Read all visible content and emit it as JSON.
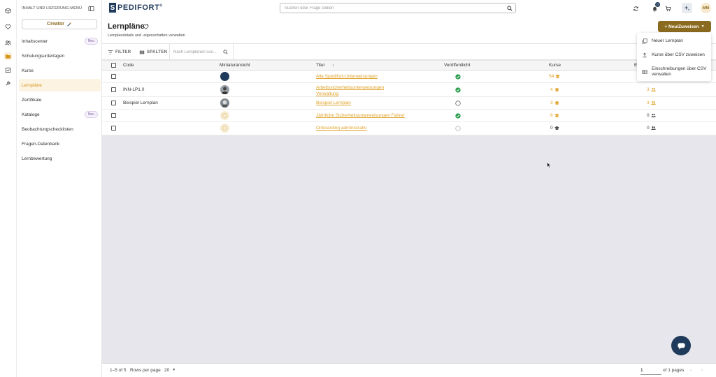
{
  "rail": {
    "icons": [
      "cube-icon",
      "heart-icon",
      "users-icon",
      "folder-icon",
      "report-icon",
      "tools-icon"
    ]
  },
  "sidebar": {
    "header": "INHALT UND LIEFERUNG-MENÜ",
    "creator_label": "Creator",
    "items": [
      {
        "label": "Inhaltscenter",
        "badge": "Neu"
      },
      {
        "label": "Schulungsunterlagen",
        "badge": ""
      },
      {
        "label": "Kurse",
        "badge": ""
      },
      {
        "label": "Lernpläne",
        "badge": ""
      },
      {
        "label": "Zertifikate",
        "badge": ""
      },
      {
        "label": "Kataloge",
        "badge": "Neu"
      },
      {
        "label": "Beobachtungschecklisten",
        "badge": ""
      },
      {
        "label": "Fragen-Datenbank",
        "badge": ""
      },
      {
        "label": "Lernbewertung",
        "badge": ""
      }
    ]
  },
  "header": {
    "logo_letter": "S",
    "logo_text": "PEDIFORT",
    "logo_reg": "®",
    "search_placeholder": "Suchen oder Frage stellen",
    "notification_count": "0",
    "avatar_initials": "MM"
  },
  "page": {
    "title": "Lernpläne",
    "subtitle": "Lernplandetails und -eigenschaften verwalten",
    "new_button": "+ Neu/Zuweisen"
  },
  "dropdown": {
    "items": [
      {
        "label": "Neuer Lernplan"
      },
      {
        "label": "Kurse über CSV zuweisen"
      },
      {
        "label": "Einschreibungen über CSV verwalten"
      }
    ]
  },
  "toolbar": {
    "filter_label": "FILTER",
    "columns_label": "SPALTEN",
    "search_placeholder": "Nach Lernplänen suc..."
  },
  "table": {
    "columns": {
      "code": "Code",
      "thumb": "Miniaturansicht",
      "title": "Titel",
      "sort": "↑",
      "published": "Veröffentlicht",
      "courses": "Kurse",
      "enroll": "E"
    },
    "rows": [
      {
        "code": "",
        "title": "Alle Spedifort-Unterweisungen",
        "published": true,
        "courses": "54",
        "enrollments": "",
        "thumb": "dark"
      },
      {
        "code": "INN-LP1.0",
        "title": "Arbeitssicherheitsunterweisungen Verwaltung",
        "published": true,
        "courses": "4",
        "enrollments": "3",
        "thumb": "photo"
      },
      {
        "code": "Beispiel Lernplan",
        "title": "Beispiel Lernplan",
        "published": false,
        "courses": "3",
        "enrollments": "3",
        "thumb": "photo2"
      },
      {
        "code": "",
        "title": "Jährliche Sicherheitsunterweisungen Fahrer",
        "published": true,
        "courses": "6",
        "enrollments": "0",
        "thumb": "placeholder"
      },
      {
        "code": "",
        "title": "Onboarding administrativ",
        "published": false,
        "courses": "0",
        "enrollments": "0",
        "thumb": "placeholder"
      }
    ]
  },
  "footer": {
    "range": "1–5 of 5",
    "rows_label": "Rows per page",
    "rows_value": "20",
    "page_value": "1",
    "of_pages": "of 1 pages"
  },
  "colors": {
    "accent": "#e0a32b",
    "brand": "#1f3a5a",
    "button": "#8a6a1f",
    "published": "#2e9e4f"
  }
}
